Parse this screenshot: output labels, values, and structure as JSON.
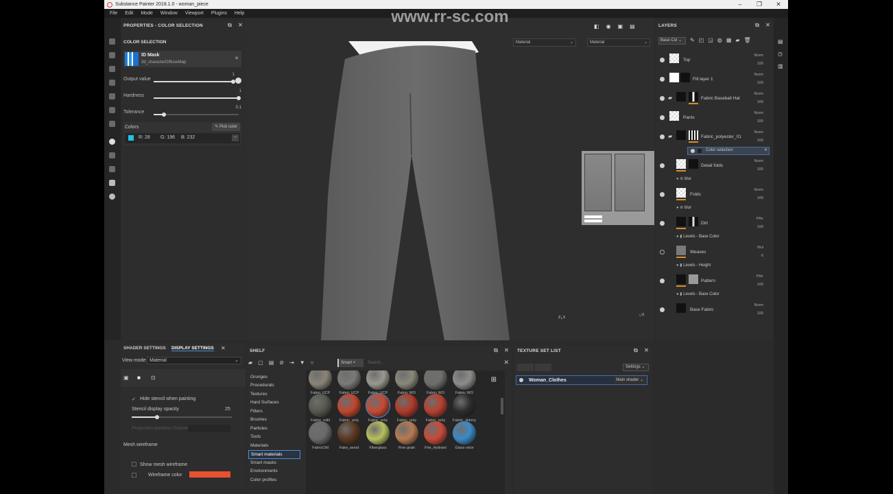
{
  "window": {
    "title": "Substance Painter 2018.1.0 - woman_piece"
  },
  "menu": [
    "File",
    "Edit",
    "Mode",
    "Window",
    "Viewport",
    "Plugins",
    "Help"
  ],
  "watermark_text": "www.rr-sc.com",
  "properties": {
    "title": "PROPERTIES - COLOR SELECTION",
    "section": "COLOR SELECTION",
    "id_mask_title": "ID Mask",
    "id_mask_map": "3d_characterDiffuseMap",
    "output_label": "Output value",
    "output_value": "1",
    "hardness_label": "Hardness",
    "hardness_value": "1",
    "tolerance_label": "Tolerance",
    "tolerance_value": "0.1",
    "colors_label": "Colors",
    "pick_color": "Pick color",
    "r": "R: 28",
    "g": "G: 196",
    "b": "B: 232",
    "swatch": "#1cc4e8"
  },
  "viewport": {
    "select_left": "Material",
    "select_right": "Material"
  },
  "layers": {
    "title": "LAYERS",
    "channel": "Base Col",
    "rows": [
      {
        "name": "Top",
        "blend": "Norm",
        "opacity": "100"
      },
      {
        "name": "Fill layer 1",
        "blend": "Norm",
        "opacity": "100"
      },
      {
        "name": "Fabric Baseball Hat",
        "blend": "Norm",
        "opacity": "100"
      },
      {
        "name": "Pants",
        "blend": "Norm",
        "opacity": "100"
      },
      {
        "name": "Fabric_polyester_01",
        "blend": "Norm",
        "opacity": "100"
      },
      {
        "name": "Detail folds",
        "blend": "Norm",
        "opacity": "100"
      },
      {
        "name": "Folds",
        "blend": "Norm",
        "opacity": "100"
      },
      {
        "name": "Dirt",
        "blend": "Pthr",
        "opacity": "100"
      },
      {
        "name": "Weaves",
        "blend": "Mul",
        "opacity": "6"
      },
      {
        "name": "Pattern",
        "blend": "Pthr",
        "opacity": "100"
      },
      {
        "name": "Base Fabric",
        "blend": "Norm",
        "opacity": "100"
      }
    ],
    "sub": {
      "color_selection": "Color selection",
      "blur1": "blur",
      "blur2": "blur",
      "levels_base1": "Levels - Base Color",
      "levels_height": "Levels - Height",
      "levels_base2": "Levels - Base Color"
    }
  },
  "display": {
    "tab1": "SHADER SETTINGS",
    "tab2": "DISPLAY SETTINGS",
    "view_mode_label": "View mode",
    "view_mode": "Material",
    "hide_stencil": "Hide stencil when painting",
    "stencil_opacity": "Stencil display opacity",
    "stencil_value": "25",
    "projection": "Projection preview channel",
    "mesh_wireframe": "Mesh wireframe",
    "show_mesh": "Show mesh wireframe",
    "wire_color": "Wireframe color",
    "wire_color_hex": "#e85030"
  },
  "shelf": {
    "title": "SHELF",
    "filter_tag": "Smart",
    "search_placeholder": "Search...",
    "categories": [
      "Grunges",
      "Procedurals",
      "Textures",
      "Hard Surfaces",
      "Filters",
      "Brushes",
      "Particles",
      "Tools",
      "Materials",
      "Smart materials",
      "Smart masks",
      "Environments",
      "Color profiles"
    ],
    "selected_category": "Smart materials",
    "items": [
      {
        "name": "Fabric UCP",
        "color": "#8a8478"
      },
      {
        "name": "Fabric UCP",
        "color": "#7a7a78"
      },
      {
        "name": "Fabric UCP",
        "color": "#9a9890"
      },
      {
        "name": "Fabric WO",
        "color": "#8a887a"
      },
      {
        "name": "Fabric WO",
        "color": "#6e6e6c"
      },
      {
        "name": "Fabric WO",
        "color": "#8c8c8a"
      },
      {
        "name": "Fabric_milit",
        "color": "#55584e"
      },
      {
        "name": "Fabric_poly",
        "color": "#c2452e"
      },
      {
        "name": "Fabric_poly",
        "color": "#c84a32"
      },
      {
        "name": "Fabric_poly",
        "color": "#b03a2a"
      },
      {
        "name": "Fabric_poly",
        "color": "#b8402e"
      },
      {
        "name": "Fabric_skinny",
        "color": "#2c2c2c"
      },
      {
        "name": "FabricOld",
        "color": "#6a6a6a"
      },
      {
        "name": "Fake_wood",
        "color": "#5a3820"
      },
      {
        "name": "Fiberglass",
        "color": "#b8c060"
      },
      {
        "name": "Fine grain",
        "color": "#b87a52"
      },
      {
        "name": "Fire_Hydrant",
        "color": "#c84a3a"
      },
      {
        "name": "Glass visor",
        "color": "#3a8ac8"
      }
    ]
  },
  "texture_set": {
    "title": "TEXTURE SET LIST",
    "settings": "Settings",
    "item": "Woman_Clothes",
    "shader": "Main shader"
  }
}
